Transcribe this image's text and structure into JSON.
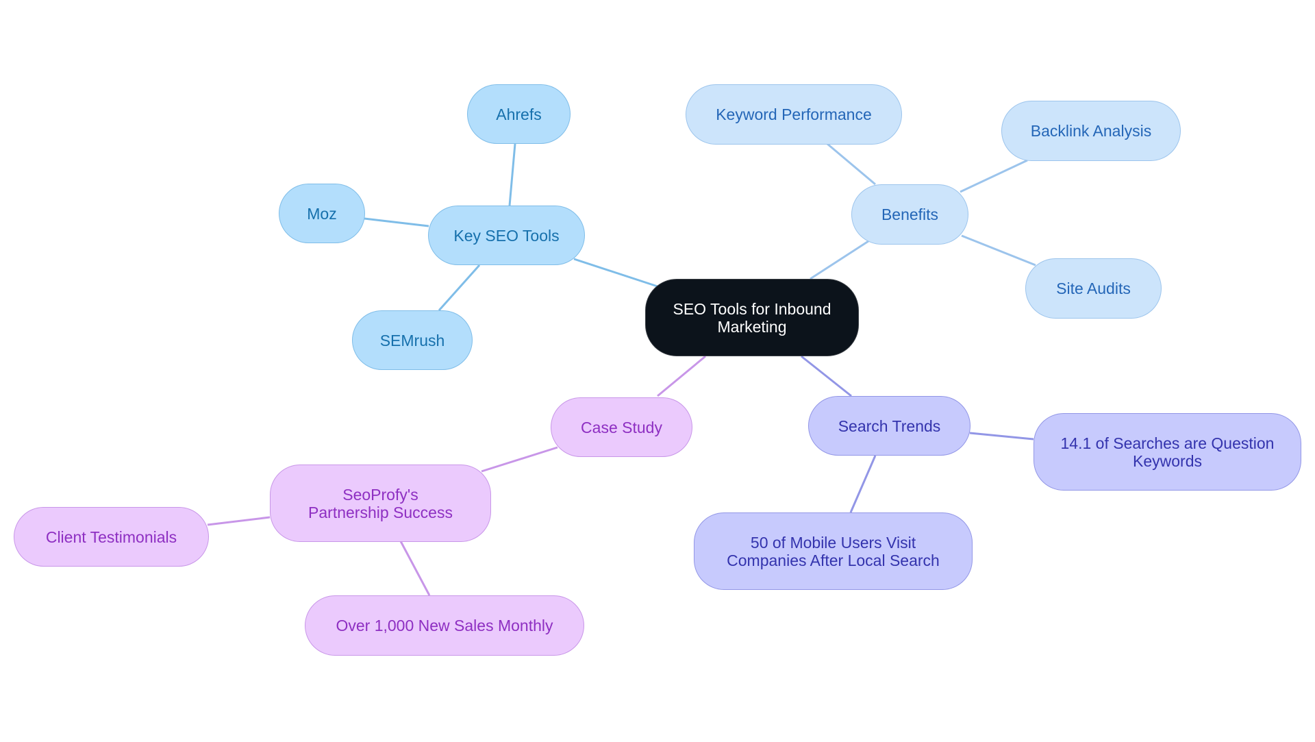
{
  "diagram": {
    "type": "mind-map",
    "root": "SEO Tools for Inbound Marketing",
    "colors": {
      "root_fill": "#0c131b",
      "key_tools_fill": "#b3defc",
      "benefits_fill": "#cce4fb",
      "search_trends_fill": "#c7cafd",
      "case_study_fill": "#ebcafd",
      "key_tools_edge": "#7fbde8",
      "benefits_edge": "#9cc4ec",
      "search_trends_edge": "#9296e6",
      "case_study_edge": "#c896e8"
    },
    "nodes": {
      "root": "SEO Tools for Inbound Marketing",
      "key_tools": "Key SEO Tools",
      "ahrefs": "Ahrefs",
      "moz": "Moz",
      "semrush": "SEMrush",
      "benefits": "Benefits",
      "keyword_performance": "Keyword Performance",
      "backlink_analysis": "Backlink Analysis",
      "site_audits": "Site Audits",
      "search_trends": "Search Trends",
      "question_keywords": "14.1 of Searches are Question Keywords",
      "mobile_users": "50 of Mobile Users Visit Companies After Local Search",
      "case_study": "Case Study",
      "seoprofy": "SeoProfy's Partnership Success",
      "client_testimonials": "Client Testimonials",
      "new_sales": "Over 1,000 New Sales Monthly"
    },
    "edges": [
      [
        "root",
        "key_tools"
      ],
      [
        "key_tools",
        "ahrefs"
      ],
      [
        "key_tools",
        "moz"
      ],
      [
        "key_tools",
        "semrush"
      ],
      [
        "root",
        "benefits"
      ],
      [
        "benefits",
        "keyword_performance"
      ],
      [
        "benefits",
        "backlink_analysis"
      ],
      [
        "benefits",
        "site_audits"
      ],
      [
        "root",
        "search_trends"
      ],
      [
        "search_trends",
        "question_keywords"
      ],
      [
        "search_trends",
        "mobile_users"
      ],
      [
        "root",
        "case_study"
      ],
      [
        "case_study",
        "seoprofy"
      ],
      [
        "seoprofy",
        "client_testimonials"
      ],
      [
        "seoprofy",
        "new_sales"
      ]
    ]
  }
}
